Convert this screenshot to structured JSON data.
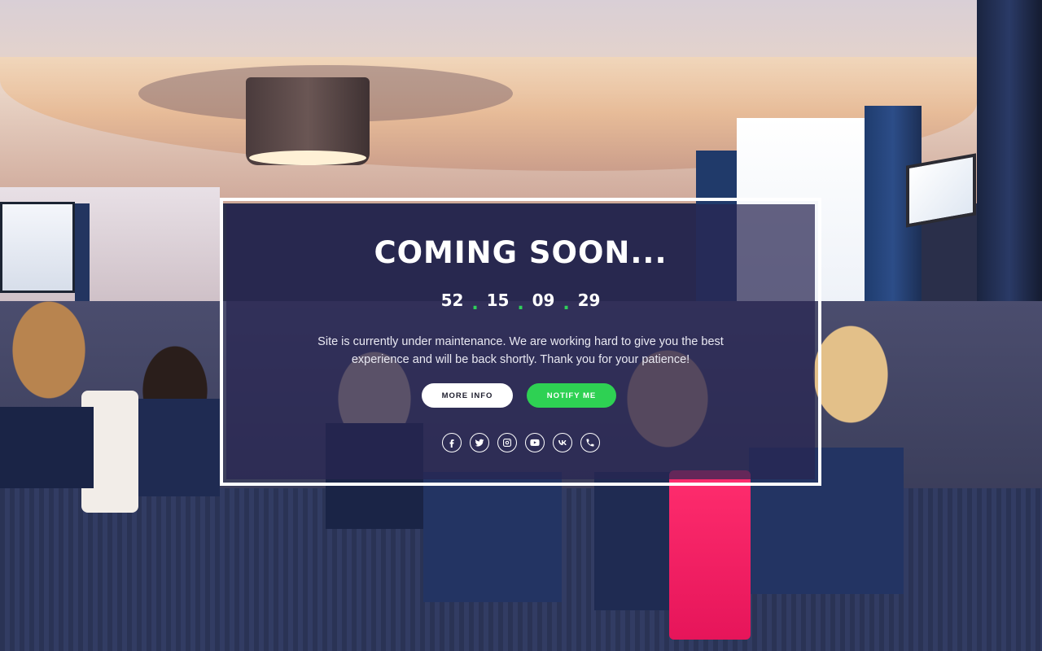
{
  "hero": {
    "title": "COMING SOON...",
    "countdown": [
      "52",
      "15",
      "09",
      "29"
    ],
    "message_line1": "Site is currently under maintenance. We are working hard to give you the best",
    "message_line2": "experience and will be back shortly. Thank you for your patience!"
  },
  "buttons": {
    "more_info": "MORE INFO",
    "notify_me": "NOTIFY ME"
  },
  "social_icons": [
    "facebook-icon",
    "twitter-icon",
    "instagram-icon",
    "youtube-icon",
    "vk-icon",
    "phone-icon"
  ],
  "colors": {
    "accent": "#2ed153",
    "panel_overlay": "#282652",
    "text": "#ffffff"
  }
}
